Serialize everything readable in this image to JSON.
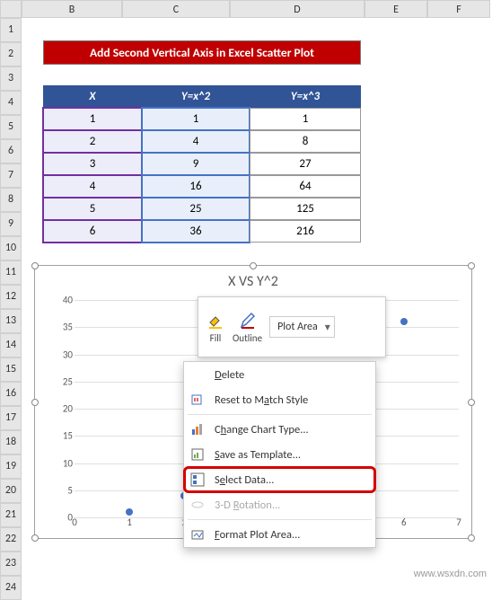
{
  "columns": [
    "A",
    "B",
    "C",
    "D",
    "E",
    "F"
  ],
  "rowsCount": 24,
  "title": "Add Second  Vertical Axis in Excel Scatter Plot",
  "table": {
    "headers": {
      "x": "X",
      "y2": "Y=x^2",
      "y3": "Y=x^3"
    },
    "rows": [
      {
        "x": "1",
        "y2": "1",
        "y3": "1"
      },
      {
        "x": "2",
        "y2": "4",
        "y3": "8"
      },
      {
        "x": "3",
        "y2": "9",
        "y3": "27"
      },
      {
        "x": "4",
        "y2": "16",
        "y3": "64"
      },
      {
        "x": "5",
        "y2": "25",
        "y3": "125"
      },
      {
        "x": "6",
        "y2": "36",
        "y3": "216"
      }
    ]
  },
  "chart_data": {
    "type": "scatter",
    "title": "X VS Y^2",
    "xlabel": "",
    "ylabel": "",
    "x": [
      1,
      2,
      3,
      4,
      5,
      6
    ],
    "series": [
      {
        "name": "Y=x^2",
        "values": [
          1,
          4,
          9,
          16,
          25,
          36
        ]
      }
    ],
    "xlim": [
      0,
      7
    ],
    "ylim": [
      0,
      40
    ],
    "xticks": [
      0,
      1,
      2,
      3,
      4,
      5,
      6,
      7
    ],
    "yticks": [
      0,
      5,
      10,
      15,
      20,
      25,
      30,
      35,
      40
    ]
  },
  "mini_toolbar": {
    "fill": "Fill",
    "outline": "Outline",
    "select_label": "Plot Area"
  },
  "context_menu": {
    "delete": "Delete",
    "reset": "Reset to Match Style",
    "change_type": "Change Chart Type...",
    "save_template": "Save as Template...",
    "select_data": "Select Data...",
    "rotation": "3-D Rotation...",
    "format_plot": "Format Plot Area..."
  },
  "watermark": "www.wsxdn.com"
}
